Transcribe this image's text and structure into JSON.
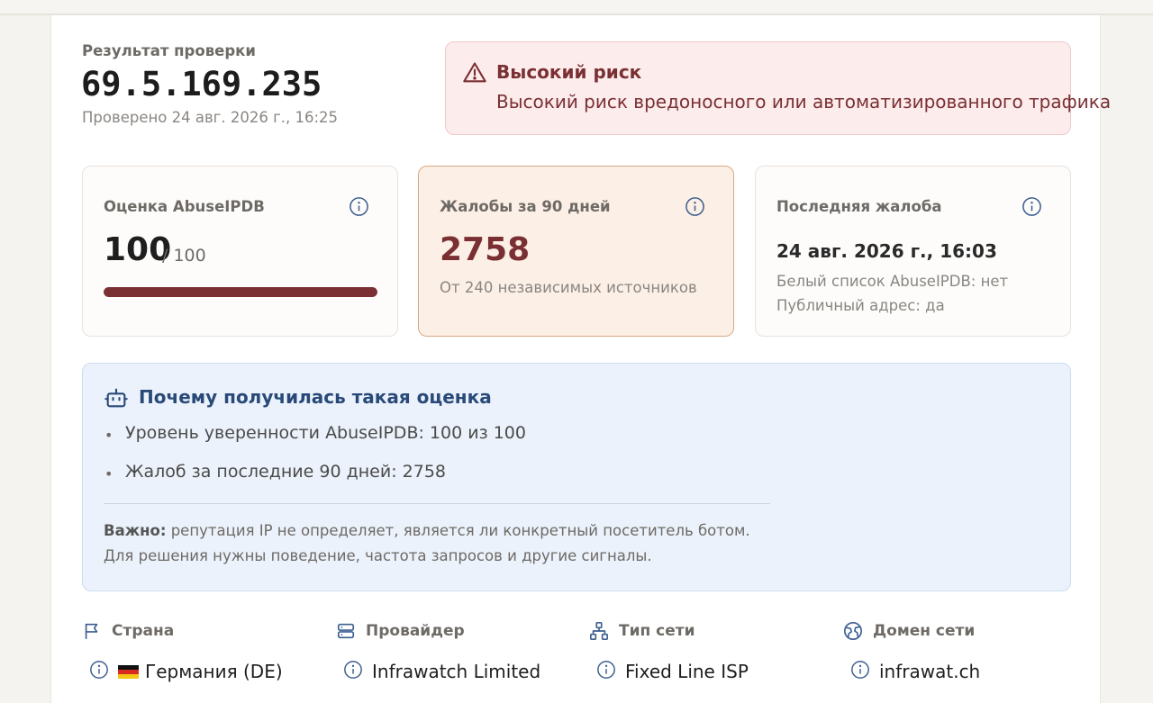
{
  "result": {
    "label": "Результат проверки",
    "ip": "69.5.169.235",
    "checked": "Проверено 24 авг. 2026 г., 16:25"
  },
  "alert": {
    "title": "Высокий риск",
    "description": "Высокий риск вредоносного или автоматизированного трафика",
    "icon": "warning-triangle-icon",
    "color": "#7a2f33"
  },
  "cards": {
    "score": {
      "title": "Оценка AbuseIPDB",
      "value": "100",
      "max": "/ 100",
      "fill_fraction": 1.0
    },
    "reports": {
      "title": "Жалобы за 90 дней",
      "value": "2758",
      "sub": "От 240 независимых источников"
    },
    "last": {
      "title": "Последняя жалоба",
      "date": "24 авг. 2026 г., 16:03",
      "whitelist": "Белый список AbuseIPDB: нет",
      "public": "Публичный адрес: да"
    }
  },
  "why": {
    "title": "Почему получилась такая оценка",
    "items": [
      "Уровень уверенности AbuseIPDB: 100 из 100",
      "Жалоб за последние 90 дней: 2758"
    ],
    "note_label": "Важно:",
    "note_text": " репутация IP не определяет, является ли конкретный посетитель ботом. Для решения нужны поведение, частота запросов и другие сигналы."
  },
  "meta": [
    {
      "label": "Страна",
      "value": "Германия (DE)",
      "icon": "flag-icon"
    },
    {
      "label": "Провайдер",
      "value": "Infrawatch Limited",
      "icon": "server-icon"
    },
    {
      "label": "Тип сети",
      "value": "Fixed Line ISP",
      "icon": "network-icon"
    },
    {
      "label": "Домен сети",
      "value": "infrawat.ch",
      "icon": "globe-icon"
    }
  ],
  "colors": {
    "accent_red": "#7a2f33",
    "accent_blue": "#294a78",
    "muted": "#8a8681"
  }
}
